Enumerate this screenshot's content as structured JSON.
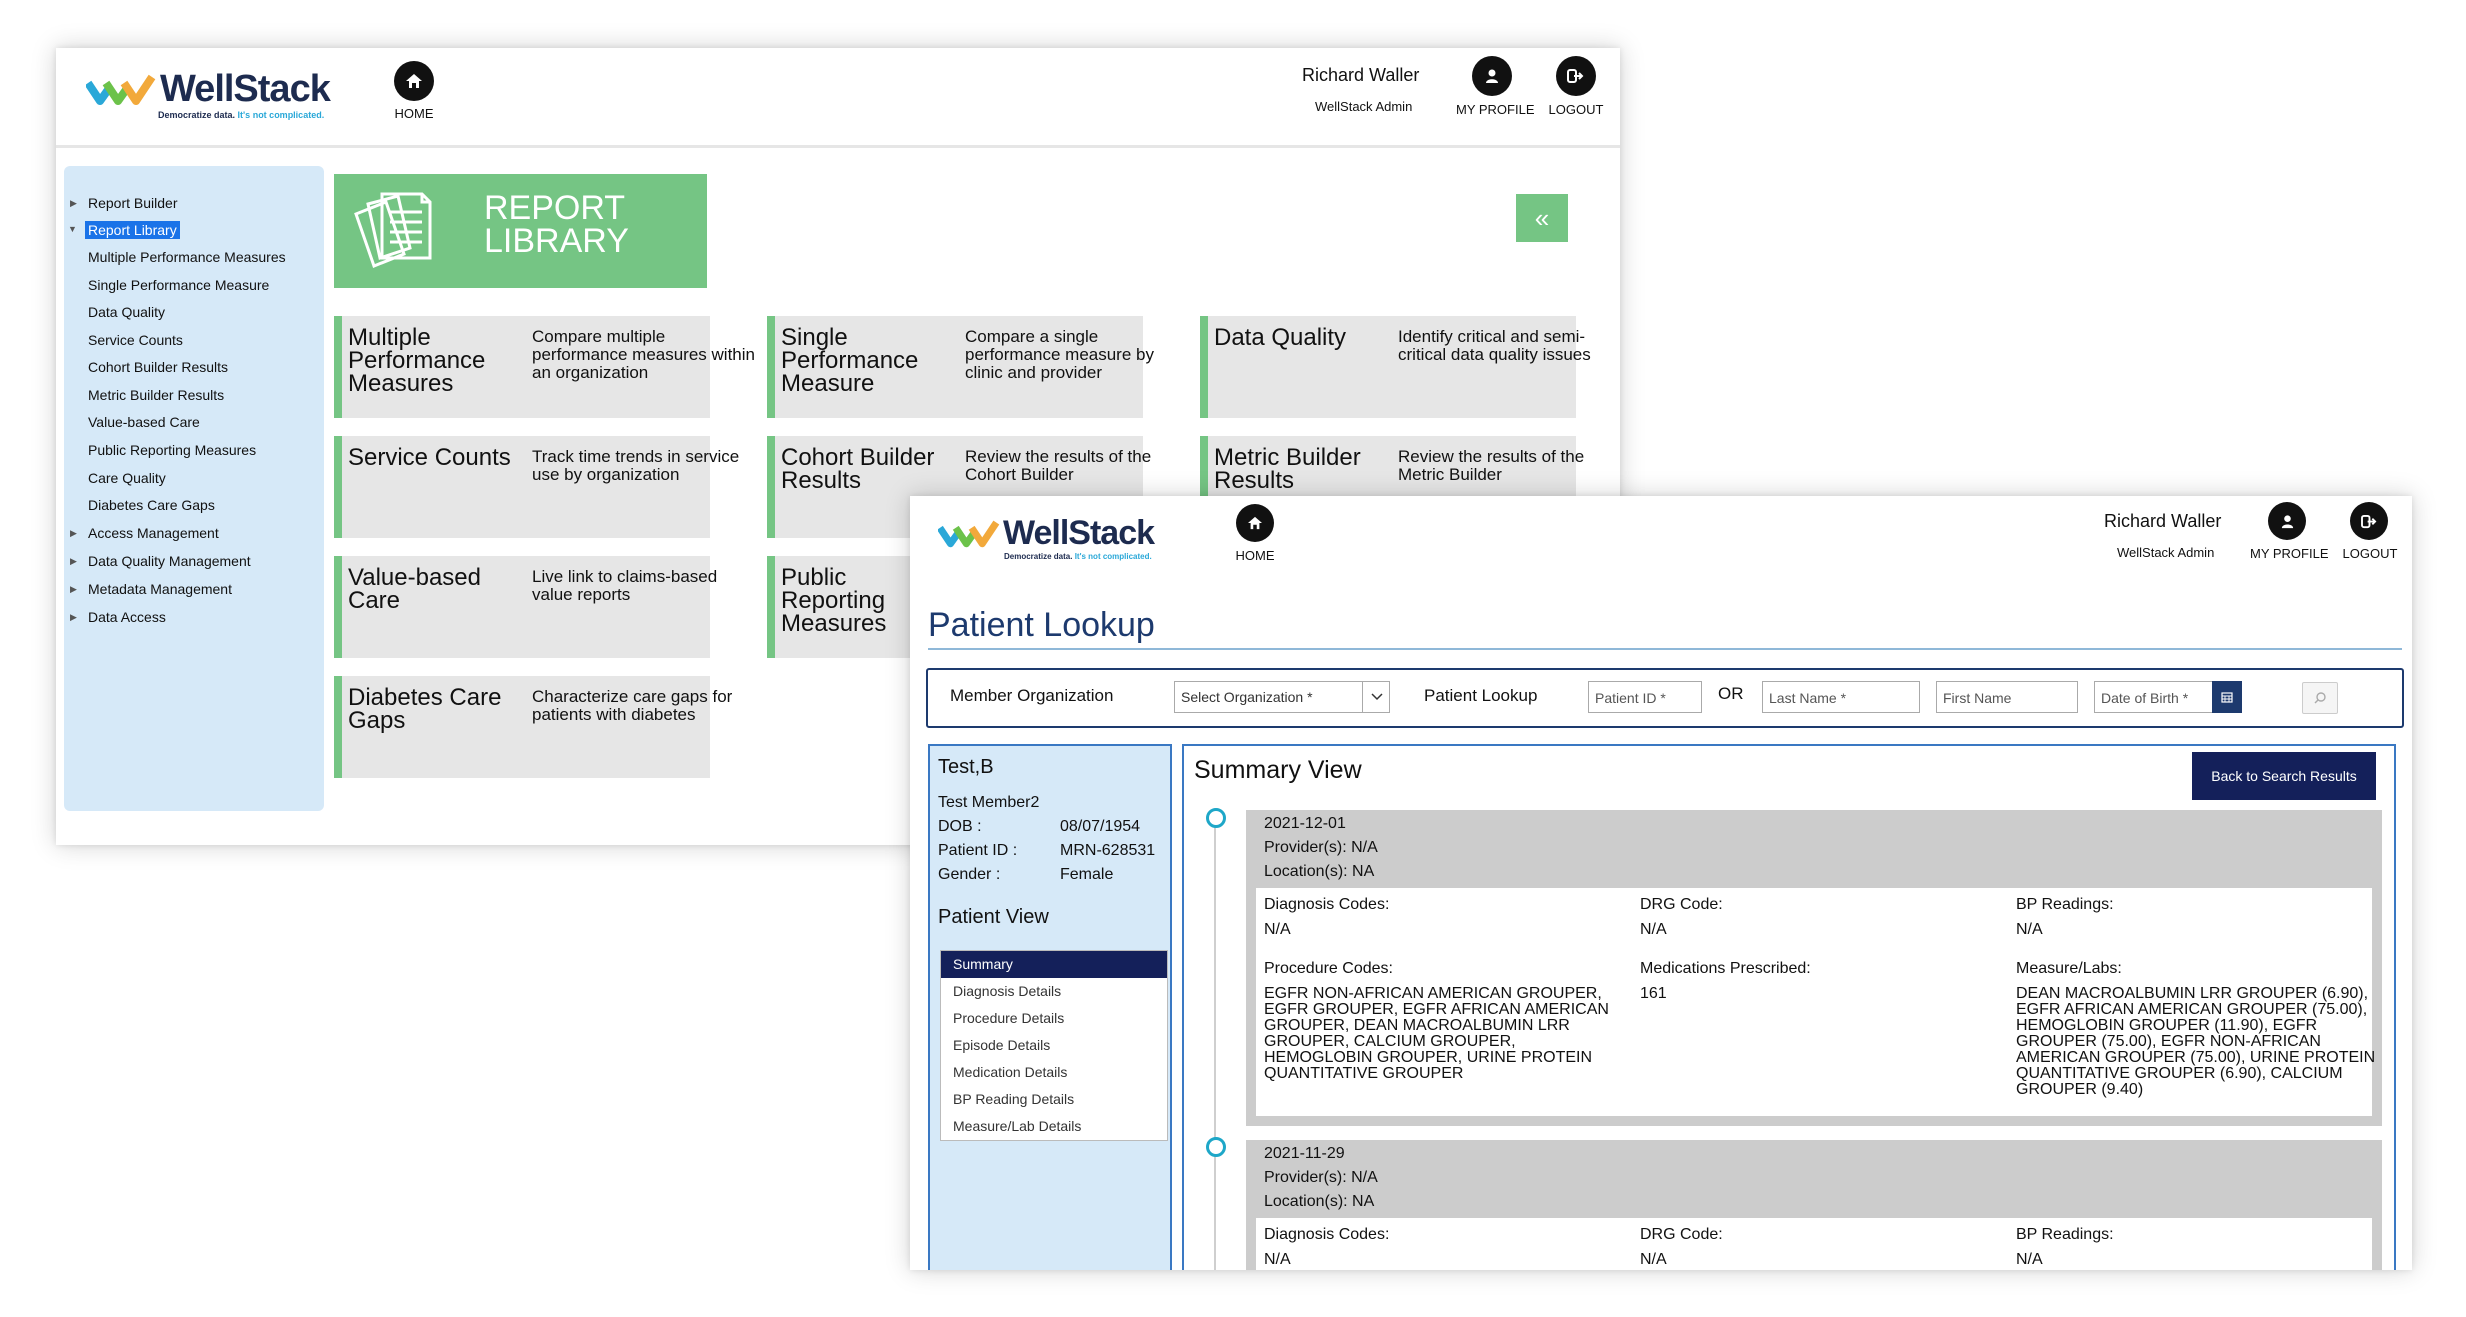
{
  "colors": {
    "brand_navy": "#1d2b4f",
    "accent_green": "#75c584",
    "sidebar_blue": "#d6e9f8",
    "selection_blue": "#1a73e8",
    "navy_button": "#14205a",
    "timeline_teal": "#1ea7c8"
  },
  "back_window": {
    "logo": {
      "text": "WellStack",
      "tagline": "Democratize data.",
      "tagline_highlight": "It's not complicated."
    },
    "nav": {
      "home_label": "HOME",
      "profile_label": "MY PROFILE",
      "logout_label": "LOGOUT"
    },
    "user": {
      "name": "Richard Waller",
      "role": "WellStack Admin"
    },
    "sidebar": {
      "groups": [
        {
          "label": "Report Builder",
          "expanded": false
        },
        {
          "label": "Report Library",
          "expanded": true,
          "selected": true
        },
        {
          "label": "Access Management",
          "expanded": false
        },
        {
          "label": "Data Quality Management",
          "expanded": false
        },
        {
          "label": "Metadata Management",
          "expanded": false
        },
        {
          "label": "Data Access",
          "expanded": false
        }
      ],
      "library_items": [
        "Multiple Performance Measures",
        "Single Performance Measure",
        "Data Quality",
        "Service Counts",
        "Cohort Builder Results",
        "Metric Builder Results",
        "Value-based Care",
        "Public Reporting Measures",
        "Care Quality",
        "Diabetes Care Gaps"
      ]
    },
    "banner": {
      "line1": "REPORT",
      "line2": "LIBRARY",
      "icon": "documents-icon"
    },
    "collapse_icon": "«",
    "cards": [
      {
        "title": "Multiple Performance Measures",
        "desc": "Compare multiple performance measures within an organization"
      },
      {
        "title": "Single Performance Measure",
        "desc": "Compare a single performance measure by clinic and provider"
      },
      {
        "title": "Data Quality",
        "desc": "Identify critical and semi-critical data quality issues"
      },
      {
        "title": "Service Counts",
        "desc": "Track time trends in service use by organization"
      },
      {
        "title": "Cohort Builder Results",
        "desc": "Review the results of the Cohort Builder"
      },
      {
        "title": "Metric Builder Results",
        "desc": "Review the results of the Metric Builder"
      },
      {
        "title": "Value-based Care",
        "desc": "Live link to claims-based value reports"
      },
      {
        "title": "Public Reporting Measures",
        "desc": ""
      },
      {
        "title": "Diabetes Care Gaps",
        "desc": "Characterize care gaps for patients with diabetes"
      }
    ]
  },
  "front_window": {
    "logo": {
      "text": "WellStack",
      "tagline": "Democratize data.",
      "tagline_highlight": "It's not complicated."
    },
    "nav": {
      "home_label": "HOME",
      "profile_label": "MY PROFILE",
      "logout_label": "LOGOUT"
    },
    "user": {
      "name": "Richard Waller",
      "role": "WellStack Admin"
    },
    "page_title": "Patient Lookup",
    "search": {
      "member_org_label": "Member Organization",
      "org_placeholder": "Select Organization *",
      "patient_lookup_label": "Patient Lookup",
      "patient_id_placeholder": "Patient ID *",
      "or_label": "OR",
      "last_name_placeholder": "Last Name *",
      "first_name_placeholder": "First Name",
      "dob_placeholder": "Date of Birth *"
    },
    "patient": {
      "name": "Test,B",
      "member": "Test Member2",
      "dob_label": "DOB :",
      "dob": "08/07/1954",
      "id_label": "Patient ID :",
      "id": "MRN-628531",
      "gender_label": "Gender :",
      "gender": "Female",
      "view_heading": "Patient View",
      "views": [
        "Summary",
        "Diagnosis Details",
        "Procedure Details",
        "Episode Details",
        "Medication Details",
        "BP Reading Details",
        "Measure/Lab Details"
      ],
      "selected_view": "Summary"
    },
    "summary": {
      "title": "Summary View",
      "back_button": "Back to Search Results",
      "field_labels": {
        "diagnosis": "Diagnosis Codes:",
        "drg": "DRG Code:",
        "bp": "BP Readings:",
        "procedure": "Procedure Codes:",
        "medications": "Medications Prescribed:",
        "measures": "Measure/Labs:"
      },
      "encounters": [
        {
          "date": "2021-12-01",
          "providers": "Provider(s): N/A",
          "locations": "Location(s): NA",
          "diagnosis": "N/A",
          "drg": "N/A",
          "bp": "N/A",
          "procedure": "EGFR NON-AFRICAN AMERICAN GROUPER, EGFR GROUPER, EGFR AFRICAN AMERICAN GROUPER, DEAN MACROALBUMIN LRR GROUPER, CALCIUM GROUPER, HEMOGLOBIN GROUPER, URINE PROTEIN QUANTITATIVE GROUPER",
          "medications": "161",
          "measures": "DEAN MACROALBUMIN LRR GROUPER (6.90), EGFR AFRICAN AMERICAN GROUPER (75.00), HEMOGLOBIN GROUPER (11.90), EGFR GROUPER (75.00), EGFR NON-AFRICAN AMERICAN GROUPER (75.00), URINE PROTEIN QUANTITATIVE GROUPER (6.90), CALCIUM GROUPER (9.40)"
        },
        {
          "date": "2021-11-29",
          "providers": "Provider(s): N/A",
          "locations": "Location(s): NA",
          "diagnosis": "N/A",
          "drg": "N/A",
          "bp": "N/A"
        }
      ]
    }
  }
}
